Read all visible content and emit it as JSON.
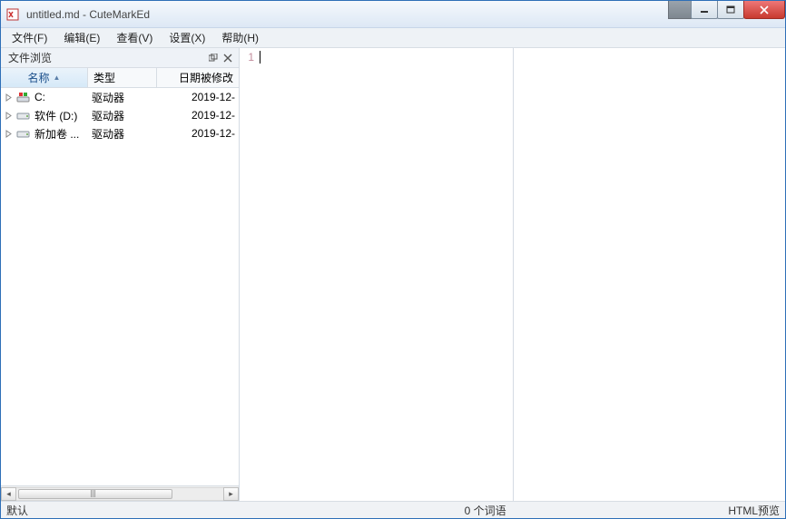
{
  "title": "untitled.md - CuteMarkEd",
  "menu": {
    "file": "文件(F)",
    "edit": "编辑(E)",
    "view": "查看(V)",
    "settings": "设置(X)",
    "help": "帮助(H)"
  },
  "panel": {
    "title": "文件浏览",
    "columns": {
      "name": "名称",
      "type": "类型",
      "date": "日期被修改"
    },
    "rows": [
      {
        "name": "C:",
        "type": "驱动器",
        "date": "2019-12-",
        "icon": "win-drive"
      },
      {
        "name": "软件 (D:)",
        "type": "驱动器",
        "date": "2019-12-",
        "icon": "hdd"
      },
      {
        "name": "新加卷 ...",
        "type": "驱动器",
        "date": "2019-12-",
        "icon": "hdd"
      }
    ]
  },
  "editor": {
    "line_number": "1"
  },
  "status": {
    "left": "默认",
    "center": "0 个词语",
    "right": "HTML预览"
  }
}
